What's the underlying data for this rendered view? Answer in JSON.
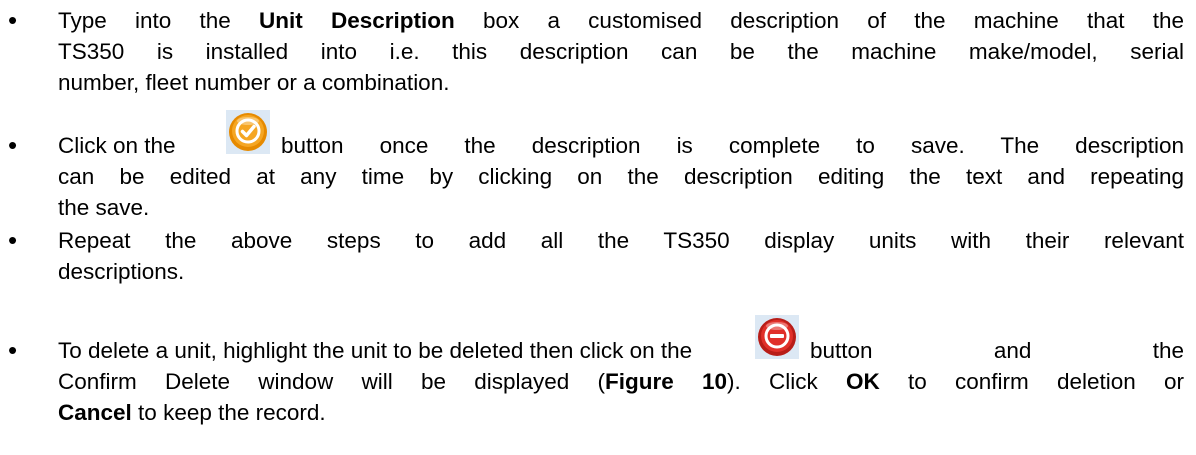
{
  "bullets": [
    {
      "lines": [
        {
          "pre": "Type into the ",
          "bold": "Unit Description",
          "post": " box a customised description of the machine that the"
        },
        {
          "text": "TS350 is installed into i.e. this description can be the machine make/model, serial"
        },
        {
          "text": "number, fleet number or a combination."
        }
      ]
    },
    {
      "lines": [
        {
          "pre": "Click on the",
          "post": "button once the description is complete to save. The description"
        },
        {
          "text": "can be edited at any time by clicking on the description editing the text and repeating"
        },
        {
          "text": "the save."
        }
      ],
      "icon": "confirm-check-icon"
    },
    {
      "lines": [
        {
          "text": "Repeat the above steps to add all the TS350 display units with their relevant"
        },
        {
          "text": "descriptions."
        }
      ]
    },
    {
      "lines": [
        {
          "pre": "To delete a unit, highlight the unit to be deleted then click on the",
          "post": "button and the"
        },
        {
          "pre": "Confirm Delete window will be displayed (",
          "bold": "Figure 10",
          "post": "). Click ",
          "bold2": "OK",
          "post2": " to confirm deletion or"
        },
        {
          "bold": "Cancel",
          "post": " to keep the record."
        }
      ],
      "icon": "delete-minus-icon"
    }
  ],
  "colors": {
    "confirm_icon": "#f5a623",
    "delete_icon": "#e0302a"
  }
}
